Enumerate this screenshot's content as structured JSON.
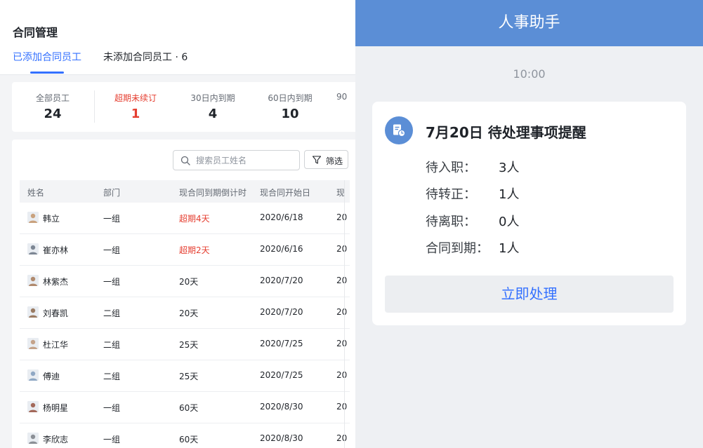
{
  "left": {
    "page_title": "合同管理",
    "tabs": [
      {
        "label": "已添加合同员工",
        "active": true
      },
      {
        "label": "未添加合同员工 · 6",
        "active": false
      }
    ],
    "stats": [
      {
        "label": "全部员工",
        "value": "24",
        "tone": "normal"
      },
      {
        "label": "超期未续订",
        "value": "1",
        "tone": "danger"
      },
      {
        "label": "30日内到期",
        "value": "4",
        "tone": "normal"
      },
      {
        "label": "60日内到期",
        "value": "10",
        "tone": "normal"
      },
      {
        "label": "90",
        "value": "",
        "tone": "normal"
      }
    ],
    "search": {
      "placeholder": "搜索员工姓名",
      "value": ""
    },
    "filter_label": "筛选",
    "table": {
      "headers": [
        "姓名",
        "部门",
        "现合同到期倒计时",
        "现合同开始日",
        "现"
      ],
      "rows": [
        {
          "name": "韩立",
          "dept": "一组",
          "countdown": "超期4天",
          "overdue": true,
          "start": "2020/6/18",
          "extra": "20"
        },
        {
          "name": "崔亦林",
          "dept": "一组",
          "countdown": "超期2天",
          "overdue": true,
          "start": "2020/6/16",
          "extra": "20"
        },
        {
          "name": "林紫杰",
          "dept": "一组",
          "countdown": "20天",
          "overdue": false,
          "start": "2020/7/20",
          "extra": "20"
        },
        {
          "name": "刘春凯",
          "dept": "二组",
          "countdown": "20天",
          "overdue": false,
          "start": "2020/7/20",
          "extra": "20"
        },
        {
          "name": "杜江华",
          "dept": "二组",
          "countdown": "25天",
          "overdue": false,
          "start": "2020/7/25",
          "extra": "20"
        },
        {
          "name": "傅迪",
          "dept": "二组",
          "countdown": "25天",
          "overdue": false,
          "start": "2020/7/25",
          "extra": "20"
        },
        {
          "name": "杨明星",
          "dept": "一组",
          "countdown": "60天",
          "overdue": false,
          "start": "2020/8/30",
          "extra": "20"
        },
        {
          "name": "李欣志",
          "dept": "一组",
          "countdown": "60天",
          "overdue": false,
          "start": "2020/8/30",
          "extra": "20"
        }
      ]
    }
  },
  "right": {
    "header_title": "人事助手",
    "timestamp": "10:00",
    "card": {
      "icon": "document-clock-icon",
      "title": "7月20日 待处理事项提醒",
      "items": [
        {
          "label": "待入职：",
          "value": "3人"
        },
        {
          "label": "待转正：",
          "value": "1人"
        },
        {
          "label": "待离职：",
          "value": "0人"
        },
        {
          "label": "合同到期：",
          "value": "1人"
        }
      ],
      "action_label": "立即处理"
    }
  },
  "colors": {
    "accent": "#3370ff",
    "danger": "#e53e30",
    "assistant_header": "#5b8ed6"
  }
}
